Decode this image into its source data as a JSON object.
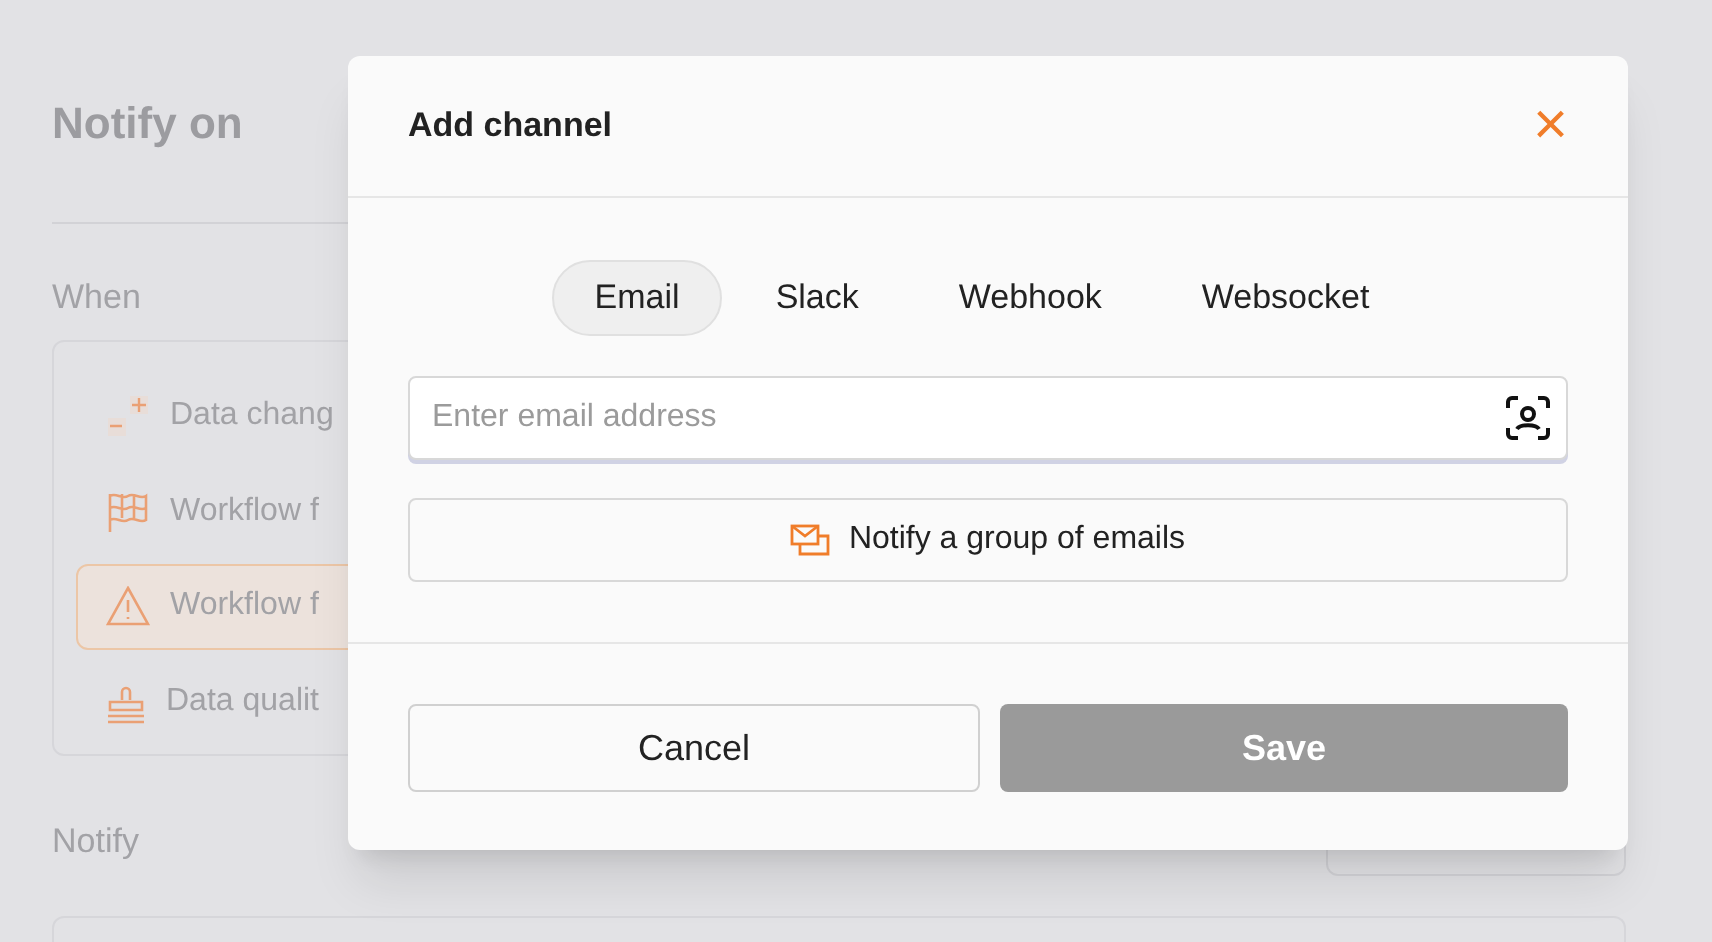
{
  "page": {
    "title": "Notify on",
    "when_label": "When",
    "notify_label": "Notify"
  },
  "triggers": [
    {
      "label": "Data chang",
      "selected": false
    },
    {
      "label": "Workflow f",
      "selected": false
    },
    {
      "label": "Workflow f",
      "selected": true
    },
    {
      "label": "Data qualit",
      "selected": false
    }
  ],
  "dialog": {
    "title": "Add channel",
    "close": "×",
    "tabs": [
      {
        "label": "Email",
        "selected": true
      },
      {
        "label": "Slack",
        "selected": false
      },
      {
        "label": "Webhook",
        "selected": false
      },
      {
        "label": "Websocket",
        "selected": false
      }
    ],
    "email_field": {
      "placeholder": "Enter email address"
    },
    "group_button": "Notify a group of emails",
    "cancel": "Cancel",
    "save": "Save"
  }
}
